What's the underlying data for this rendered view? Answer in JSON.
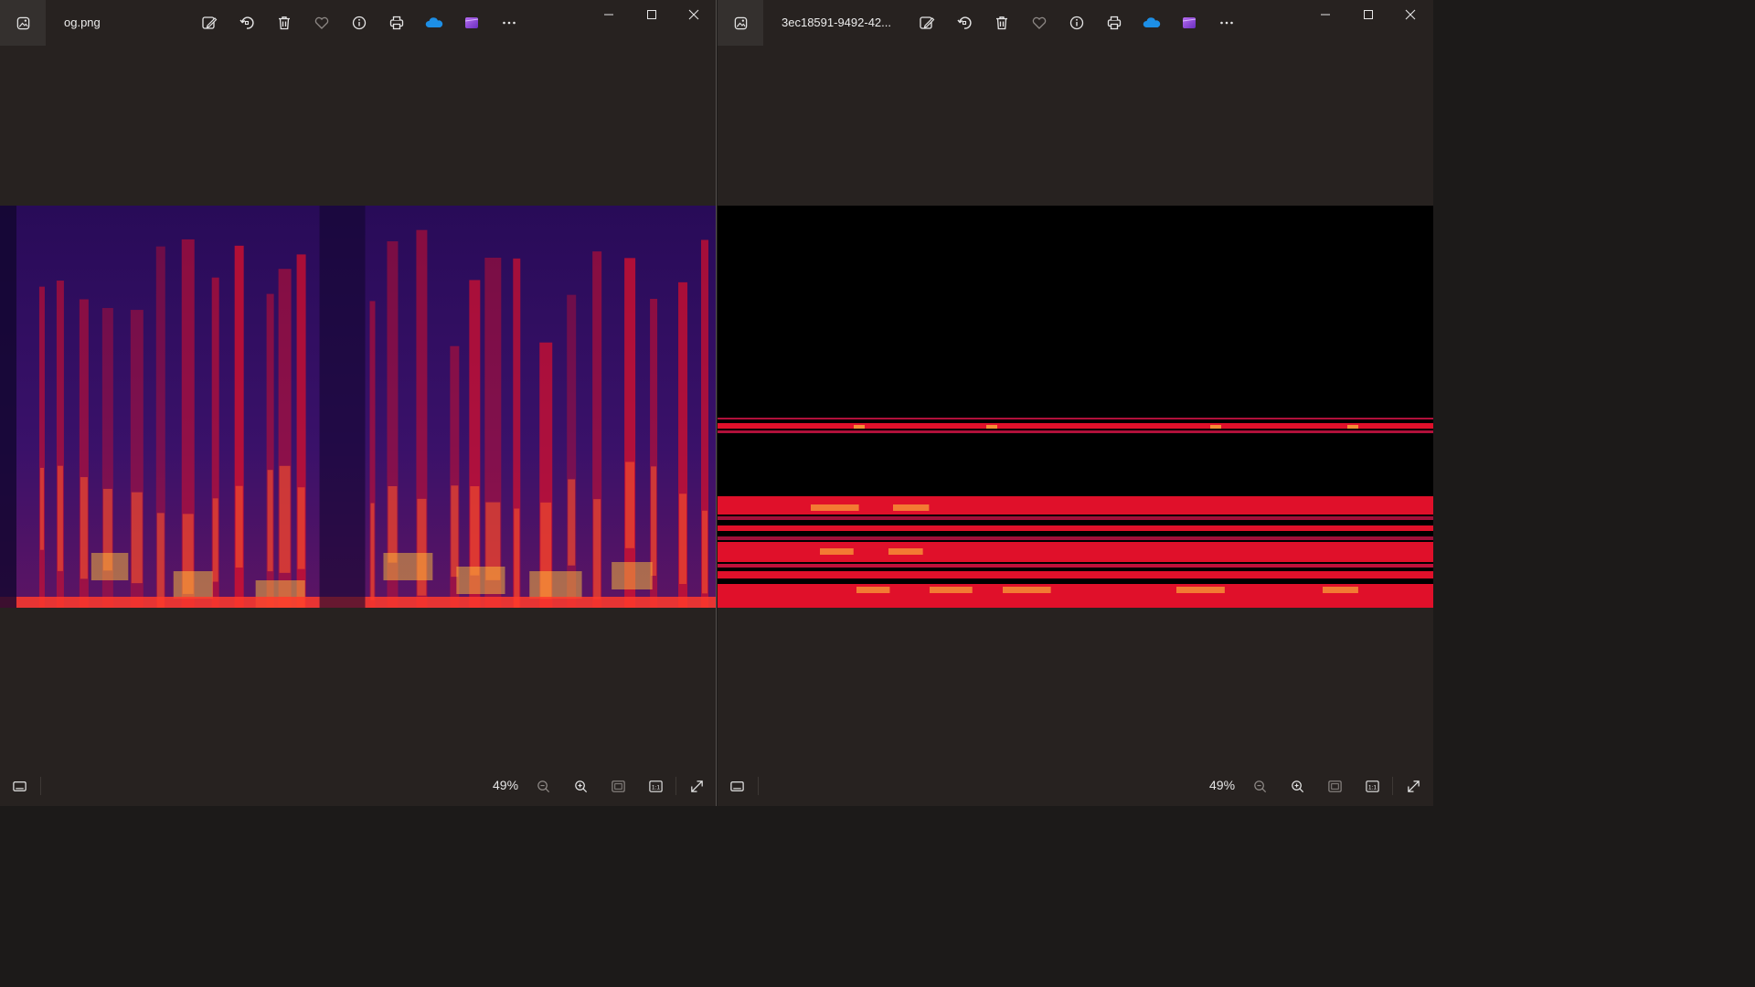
{
  "windows": [
    {
      "title": "og.png",
      "zoom": "49%",
      "image_kind": "spectrogram-original"
    },
    {
      "title": "3ec18591-9492-42...",
      "zoom": "49%",
      "image_kind": "spectrogram-processed"
    }
  ],
  "toolbar_icons": [
    "edit-image-icon",
    "rotate-icon",
    "delete-icon",
    "favorite-icon",
    "info-icon",
    "print-icon",
    "onedrive-icon",
    "clipchamp-icon",
    "more-icon"
  ],
  "colors": {
    "window_bg": "#272220",
    "onedrive": "#1d8fe6",
    "clipchamp": "#8a4bd8",
    "spectro_dark": "#12062e",
    "spectro_red": "#e0102a",
    "spectro_hot": "#ffc23a"
  }
}
